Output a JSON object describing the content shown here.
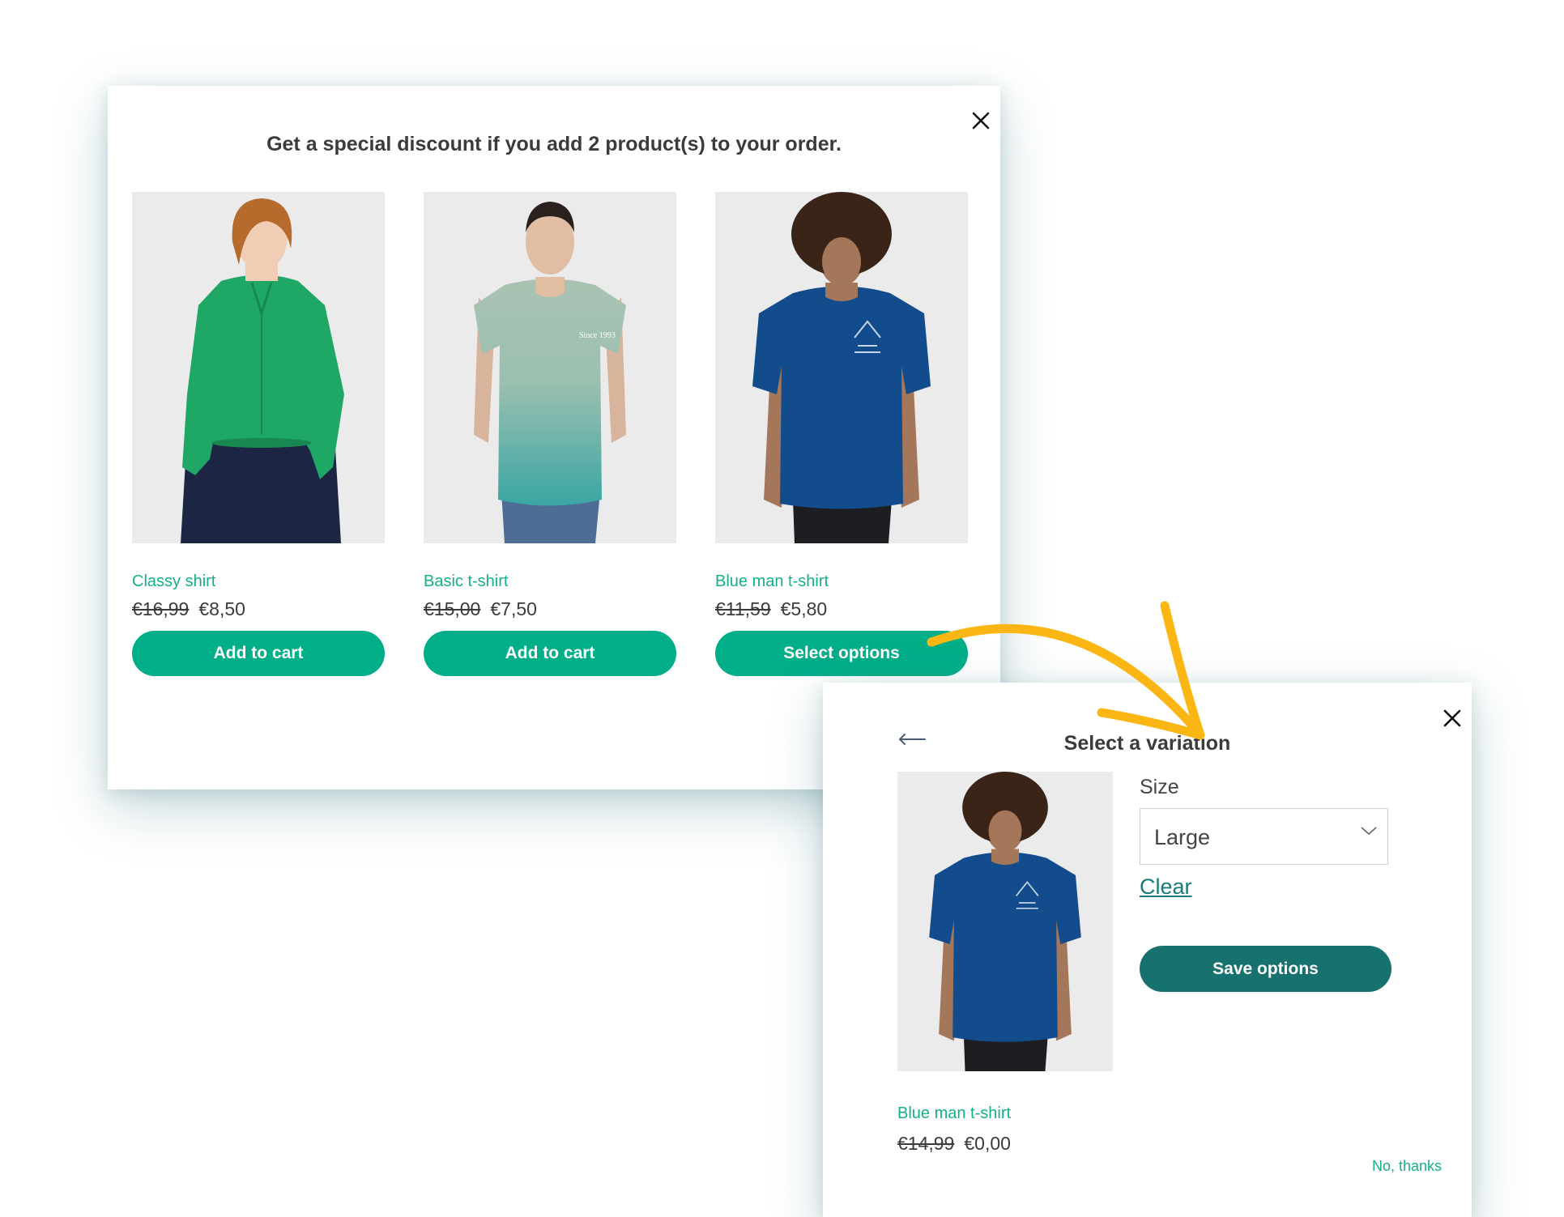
{
  "colors": {
    "accent": "#00ae88",
    "accent_dark": "#17726f",
    "arrow": "#fbb614"
  },
  "offer_modal": {
    "title": "Get a special discount if you add 2 product(s) to your order.",
    "close_icon": "close-icon",
    "products": [
      {
        "name": "Classy shirt",
        "old_price": "€16,99",
        "price": "€8,50",
        "button": "Add to cart",
        "image": "woman-green-blouse"
      },
      {
        "name": "Basic t-shirt",
        "old_price": "€15,00",
        "price": "€7,50",
        "button": "Add to cart",
        "image": "man-gradient-tshirt"
      },
      {
        "name": "Blue man t-shirt",
        "old_price": "€11,59",
        "price": "€5,80",
        "button": "Select options",
        "image": "man-blue-adidas-tshirt"
      }
    ]
  },
  "variation_modal": {
    "title": "Select a variation",
    "back_icon": "back-arrow-icon",
    "close_icon": "close-icon",
    "attribute_label": "Size",
    "selected_value": "Large",
    "clear_label": "Clear",
    "save_label": "Save options",
    "product_name": "Blue man t-shirt",
    "old_price": "€14,99",
    "price": "€0,00",
    "dismiss_label": "No, thanks"
  }
}
